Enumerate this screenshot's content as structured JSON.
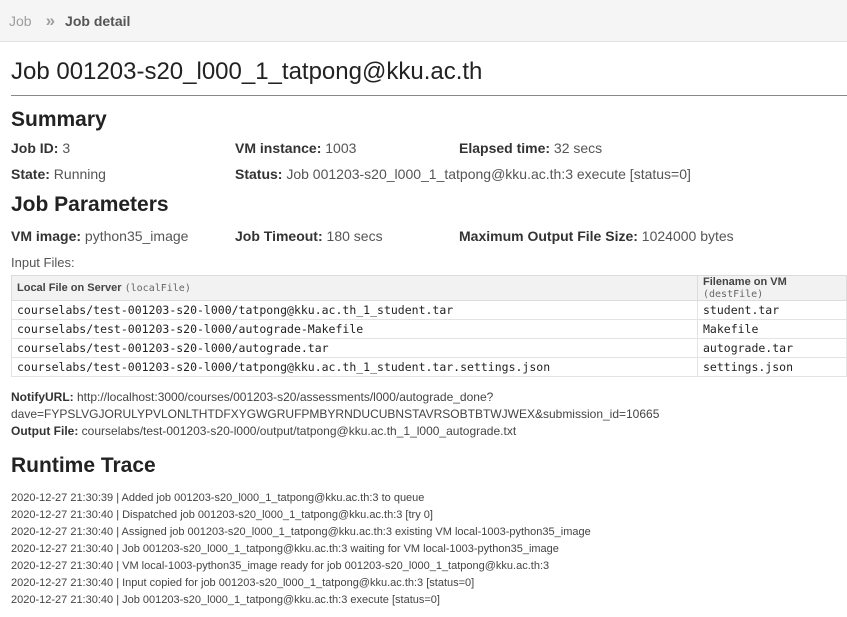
{
  "breadcrumb": {
    "parent": "Job",
    "separator": "»",
    "current": "Job detail"
  },
  "page_title": "Job 001203-s20_l000_1_tatpong@kku.ac.th",
  "summary": {
    "heading": "Summary",
    "job_id_label": "Job ID:",
    "job_id": "3",
    "vm_instance_label": "VM instance:",
    "vm_instance": "1003",
    "elapsed_label": "Elapsed time:",
    "elapsed": "32 secs",
    "state_label": "State:",
    "state": "Running",
    "status_label": "Status:",
    "status": "Job 001203-s20_l000_1_tatpong@kku.ac.th:3 execute [status=0]"
  },
  "params": {
    "heading": "Job Parameters",
    "vm_image_label": "VM image:",
    "vm_image": "python35_image",
    "timeout_label": "Job Timeout:",
    "timeout": "180 secs",
    "max_output_label": "Maximum Output File Size:",
    "max_output": "1024000 bytes",
    "input_files_label": "Input Files:"
  },
  "files_table": {
    "col1_label": "Local File on Server",
    "col1_code": "(localFile)",
    "col2_label": "Filename on VM",
    "col2_code": "(destFile)",
    "rows": [
      {
        "local": "courselabs/test-001203-s20-l000/tatpong@kku.ac.th_1_student.tar",
        "dest": "student.tar"
      },
      {
        "local": "courselabs/test-001203-s20-l000/autograde-Makefile",
        "dest": "Makefile"
      },
      {
        "local": "courselabs/test-001203-s20-l000/autograde.tar",
        "dest": "autograde.tar"
      },
      {
        "local": "courselabs/test-001203-s20-l000/tatpong@kku.ac.th_1_student.tar.settings.json",
        "dest": "settings.json"
      }
    ]
  },
  "notify": {
    "label": "NotifyURL:",
    "url_line1": "http://localhost:3000/courses/001203-s20/assessments/l000/autograde_done?",
    "url_line2": "dave=FYPSLVGJORULYPVLONLTHTDFXYGWGRUFPMBYRNDUCUBNSTAVRSOBTBTWJWEX&submission_id=10665",
    "output_label": "Output File:",
    "output": "courselabs/test-001203-s20-l000/output/tatpong@kku.ac.th_1_l000_autograde.txt"
  },
  "trace": {
    "heading": "Runtime Trace",
    "lines": [
      "2020-12-27 21:30:39 | Added job 001203-s20_l000_1_tatpong@kku.ac.th:3 to queue",
      "2020-12-27 21:30:40 | Dispatched job 001203-s20_l000_1_tatpong@kku.ac.th:3 [try 0]",
      "2020-12-27 21:30:40 | Assigned job 001203-s20_l000_1_tatpong@kku.ac.th:3 existing VM local-1003-python35_image",
      "2020-12-27 21:30:40 | Job 001203-s20_l000_1_tatpong@kku.ac.th:3 waiting for VM local-1003-python35_image",
      "2020-12-27 21:30:40 | VM local-1003-python35_image ready for job 001203-s20_l000_1_tatpong@kku.ac.th:3",
      "2020-12-27 21:30:40 | Input copied for job 001203-s20_l000_1_tatpong@kku.ac.th:3 [status=0]",
      "2020-12-27 21:30:40 | Job 001203-s20_l000_1_tatpong@kku.ac.th:3 execute [status=0]"
    ]
  }
}
